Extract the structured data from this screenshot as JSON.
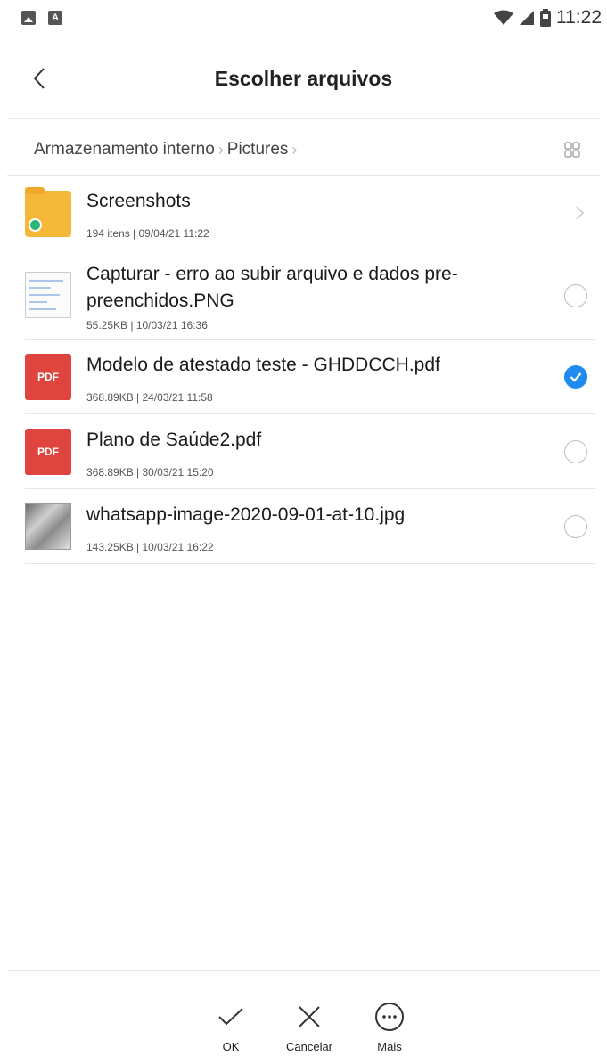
{
  "status_bar": {
    "time": "11:22",
    "left_icons": [
      "image-notification-icon",
      "a-notification-icon"
    ],
    "right_icons": [
      "wifi-icon",
      "cell-signal-icon",
      "battery-icon"
    ]
  },
  "header": {
    "title": "Escolher arquivos",
    "back_icon": "chevron-left-icon"
  },
  "breadcrumb": {
    "items": [
      "Armazenamento interno",
      "Pictures"
    ],
    "view_toggle_icon": "grid-icon"
  },
  "files": [
    {
      "name": "Screenshots",
      "meta": "194 itens | 09/04/21 11:22",
      "type": "folder",
      "trailing": "chevron"
    },
    {
      "name": "Capturar - erro ao subir arquivo e dados pre-preenchidos.PNG",
      "meta": "55.25KB | 10/03/21 16:36",
      "type": "image-doc",
      "trailing": "radio",
      "checked": false
    },
    {
      "name": "Modelo de atestado teste - GHDDCCH.pdf",
      "meta": "368.89KB | 24/03/21 11:58",
      "type": "pdf",
      "trailing": "radio",
      "checked": true
    },
    {
      "name": "Plano de Saúde2.pdf",
      "meta": "368.89KB | 30/03/21 15:20",
      "type": "pdf",
      "trailing": "radio",
      "checked": false
    },
    {
      "name": "whatsapp-image-2020-09-01-at-10.jpg",
      "meta": "143.25KB | 10/03/21 16:22",
      "type": "photo",
      "trailing": "radio",
      "checked": false
    }
  ],
  "pdf_label": "PDF",
  "bottom_actions": {
    "ok": "OK",
    "cancel": "Cancelar",
    "more": "Mais"
  },
  "colors": {
    "accent": "#1e8bf0",
    "folder": "#f5b93a",
    "pdf": "#e0443e"
  }
}
